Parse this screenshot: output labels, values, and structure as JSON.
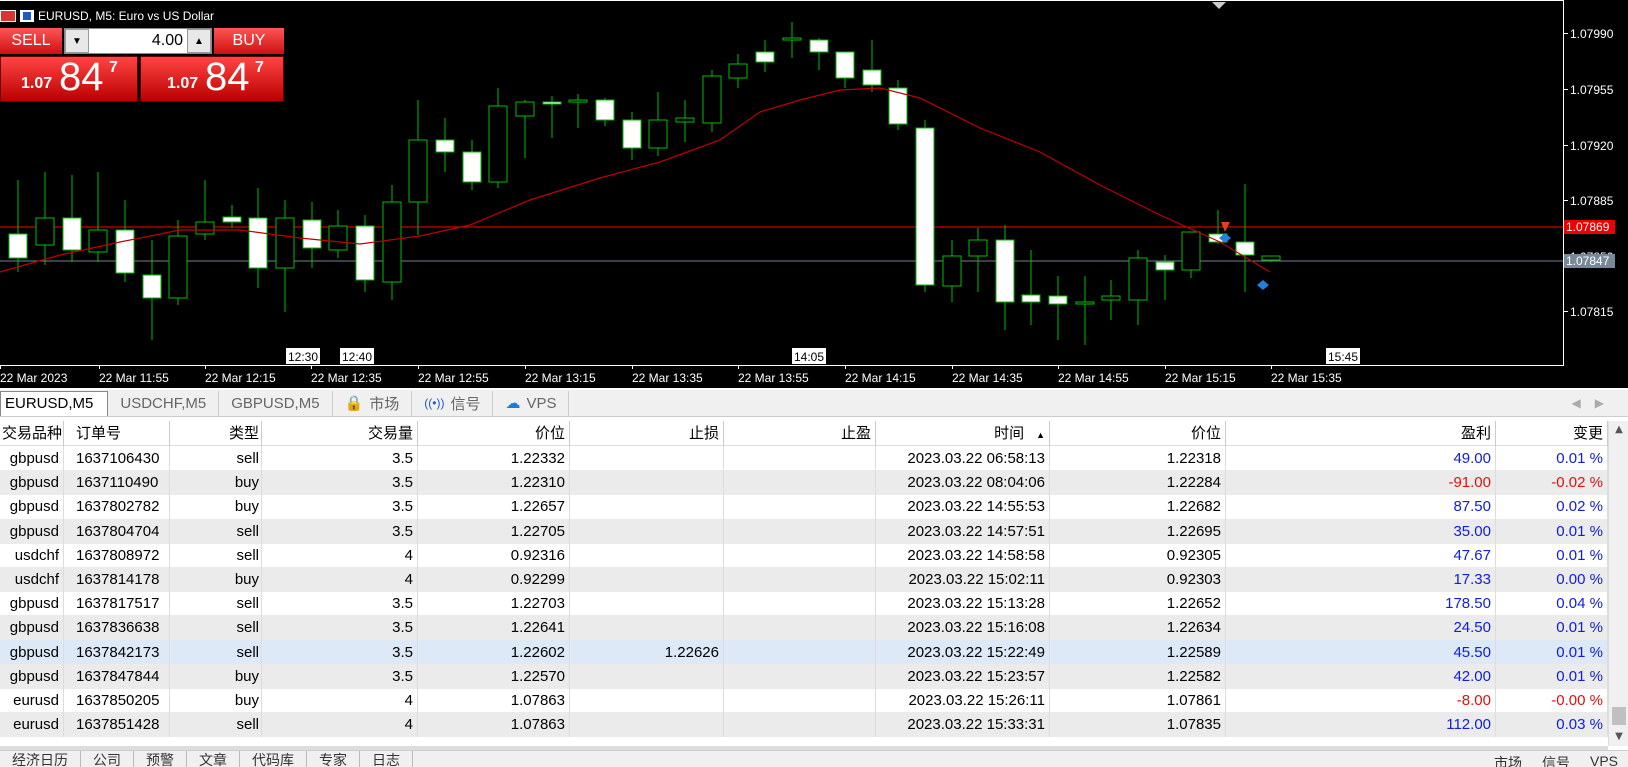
{
  "chart": {
    "symbol_title": "EURUSD, M5:  Euro vs US Dollar",
    "price_labels": [
      "1.07990",
      "1.07955",
      "1.07920",
      "1.07885",
      "1.07850",
      "1.07815"
    ],
    "bid_tag": "1.07847",
    "ask_line_tag": "1.07869",
    "time_labels": [
      "22 Mar 2023",
      "22 Mar 11:55",
      "22 Mar 12:15",
      "22 Mar 12:35",
      "22 Mar 12:55",
      "22 Mar 13:15",
      "22 Mar 13:35",
      "22 Mar 13:55",
      "22 Mar 14:15",
      "22 Mar 14:35",
      "22 Mar 14:55",
      "22 Mar 15:15",
      "22 Mar 15:35"
    ],
    "time_markers": [
      "12:30",
      "12:40",
      "14:05",
      "15:45"
    ],
    "colors": {
      "background": "#000000",
      "bull": "#00c000",
      "candle_body": "#ffffff",
      "ma": "#c00000",
      "ask_line": "#ff0000",
      "bid_line": "#708090"
    }
  },
  "one_click": {
    "sell_label": "SELL",
    "buy_label": "BUY",
    "lot_value": "4.00",
    "sell_price": {
      "pre": "1.07",
      "big": "84",
      "sup": "7"
    },
    "buy_price": {
      "pre": "1.07",
      "big": "84",
      "sup": "7"
    }
  },
  "tabs": [
    {
      "label": "EURUSD,M5"
    },
    {
      "label": "USDCHF,M5"
    },
    {
      "label": "GBPUSD,M5"
    },
    {
      "label": "市场"
    },
    {
      "label": "信号"
    },
    {
      "label": "VPS"
    }
  ],
  "table": {
    "headers": [
      "交易品种",
      "订单号",
      "类型",
      "交易量",
      "价位",
      "止损",
      "止盈",
      "时间",
      "价位",
      "盈利",
      "变更"
    ],
    "rows": [
      [
        "gbpusd",
        "1637106430",
        "sell",
        "3.5",
        "1.22332",
        "",
        "",
        "2023.03.22 06:58:13",
        "1.22318",
        "49.00",
        "0.01 %"
      ],
      [
        "gbpusd",
        "1637110490",
        "buy",
        "3.5",
        "1.22310",
        "",
        "",
        "2023.03.22 08:04:06",
        "1.22284",
        "-91.00",
        "-0.02 %"
      ],
      [
        "gbpusd",
        "1637802782",
        "buy",
        "3.5",
        "1.22657",
        "",
        "",
        "2023.03.22 14:55:53",
        "1.22682",
        "87.50",
        "0.02 %"
      ],
      [
        "gbpusd",
        "1637804704",
        "sell",
        "3.5",
        "1.22705",
        "",
        "",
        "2023.03.22 14:57:51",
        "1.22695",
        "35.00",
        "0.01 %"
      ],
      [
        "usdchf",
        "1637808972",
        "sell",
        "4",
        "0.92316",
        "",
        "",
        "2023.03.22 14:58:58",
        "0.92305",
        "47.67",
        "0.01 %"
      ],
      [
        "usdchf",
        "1637814178",
        "buy",
        "4",
        "0.92299",
        "",
        "",
        "2023.03.22 15:02:11",
        "0.92303",
        "17.33",
        "0.00 %"
      ],
      [
        "gbpusd",
        "1637817517",
        "sell",
        "3.5",
        "1.22703",
        "",
        "",
        "2023.03.22 15:13:28",
        "1.22652",
        "178.50",
        "0.04 %"
      ],
      [
        "gbpusd",
        "1637836638",
        "sell",
        "3.5",
        "1.22641",
        "",
        "",
        "2023.03.22 15:16:08",
        "1.22634",
        "24.50",
        "0.01 %"
      ],
      [
        "gbpusd",
        "1637842173",
        "sell",
        "3.5",
        "1.22602",
        "1.22626",
        "",
        "2023.03.22 15:22:49",
        "1.22589",
        "45.50",
        "0.01 %"
      ],
      [
        "gbpusd",
        "1637847844",
        "buy",
        "3.5",
        "1.22570",
        "",
        "",
        "2023.03.22 15:23:57",
        "1.22582",
        "42.00",
        "0.01 %"
      ],
      [
        "eurusd",
        "1637850205",
        "buy",
        "4",
        "1.07863",
        "",
        "",
        "2023.03.22 15:26:11",
        "1.07861",
        "-8.00",
        "-0.00 %"
      ],
      [
        "eurusd",
        "1637851428",
        "sell",
        "4",
        "1.07863",
        "",
        "",
        "2023.03.22 15:33:31",
        "1.07835",
        "112.00",
        "0.03 %"
      ]
    ]
  },
  "bottom_tabs": [
    "经济日历",
    "公司",
    "预警",
    "文章",
    "代码库",
    "专家",
    "日志"
  ],
  "status_right": [
    "市场",
    "信号",
    "VPS"
  ]
}
